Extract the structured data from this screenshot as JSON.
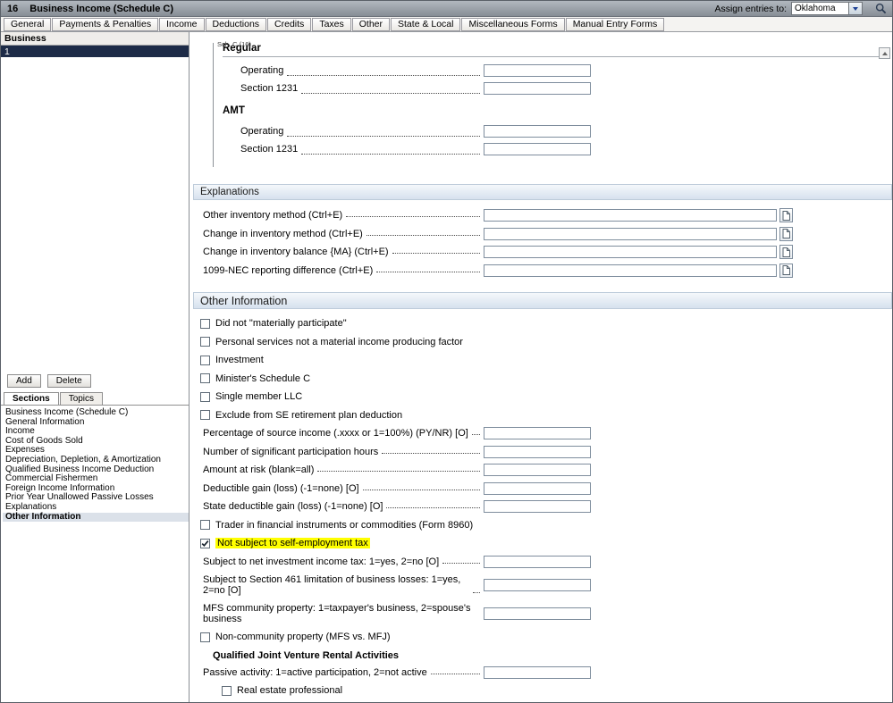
{
  "title_bar": {
    "form_number": "16",
    "title": "Business Income (Schedule C)",
    "assign_entries_label": "Assign entries to:",
    "assign_entries_value": "Oklahoma"
  },
  "tabs": [
    "General",
    "Payments & Penalties",
    "Income",
    "Deductions",
    "Credits",
    "Taxes",
    "Other",
    "State & Local",
    "Miscellaneous Forms",
    "Manual Entry Forms"
  ],
  "sidebar": {
    "header": "Business",
    "business_items": [
      {
        "label": "1",
        "selected": true
      }
    ],
    "buttons": {
      "add": "Add",
      "delete": "Delete"
    },
    "tabs": [
      {
        "label": "Sections",
        "active": true
      },
      {
        "label": "Topics",
        "active": false
      }
    ],
    "section_list": [
      {
        "label": "Business Income (Schedule C)",
        "selected": false
      },
      {
        "label": "General Information",
        "selected": false
      },
      {
        "label": "Income",
        "selected": false
      },
      {
        "label": "Cost of Goods Sold",
        "selected": false
      },
      {
        "label": "Expenses",
        "selected": false
      },
      {
        "label": "Depreciation, Depletion, & Amortization",
        "selected": false
      },
      {
        "label": "Qualified Business Income Deduction",
        "selected": false
      },
      {
        "label": "Commercial Fishermen",
        "selected": false
      },
      {
        "label": "Foreign Income Information",
        "selected": false
      },
      {
        "label": "Prior Year Unallowed Passive Losses",
        "selected": false
      },
      {
        "label": "Explanations",
        "selected": false
      },
      {
        "label": "Other Information",
        "selected": true
      }
    ]
  },
  "content": {
    "form_tag": "Sch. C  (16)",
    "gains": {
      "groups": [
        {
          "heading": "Regular",
          "rows": [
            {
              "label": "Operating",
              "value": ""
            },
            {
              "label": "Section 1231",
              "value": ""
            }
          ]
        },
        {
          "heading": "AMT",
          "rows": [
            {
              "label": "Operating",
              "value": ""
            },
            {
              "label": "Section 1231",
              "value": ""
            }
          ]
        }
      ]
    },
    "explanations": {
      "heading": "Explanations",
      "rows": [
        {
          "label": "Other inventory method (Ctrl+E)",
          "value": ""
        },
        {
          "label": "Change in inventory method (Ctrl+E)",
          "value": ""
        },
        {
          "label": "Change in inventory balance {MA} (Ctrl+E)",
          "value": ""
        },
        {
          "label": "1099-NEC reporting difference (Ctrl+E)",
          "value": ""
        }
      ]
    },
    "other_information": {
      "heading": "Other Information",
      "rows": [
        {
          "type": "checkbox",
          "label": "Did not \"materially participate\"",
          "checked": false
        },
        {
          "type": "checkbox",
          "label": "Personal services not a material income producing factor",
          "checked": false
        },
        {
          "type": "checkbox",
          "label": "Investment",
          "checked": false
        },
        {
          "type": "checkbox",
          "label": "Minister's Schedule C",
          "checked": false
        },
        {
          "type": "checkbox",
          "label": "Single member LLC",
          "checked": false
        },
        {
          "type": "checkbox",
          "label": "Exclude from SE retirement plan deduction",
          "checked": false
        },
        {
          "type": "field",
          "label": "Percentage of source income (.xxxx or 1=100%) (PY/NR) [O]",
          "value": ""
        },
        {
          "type": "field",
          "label": "Number of significant participation hours",
          "value": ""
        },
        {
          "type": "field",
          "label": "Amount at risk (blank=all)",
          "value": ""
        },
        {
          "type": "field",
          "label": "Deductible gain (loss) (-1=none) [O]",
          "value": ""
        },
        {
          "type": "field",
          "label": "State deductible gain (loss) (-1=none) [O]",
          "value": ""
        },
        {
          "type": "checkbox",
          "label": "Trader in financial instruments or commodities (Form 8960)",
          "checked": false
        },
        {
          "type": "checkbox",
          "label": "Not subject to self-employment tax",
          "checked": true,
          "highlight": true
        },
        {
          "type": "field",
          "label": "Subject to net investment income tax: 1=yes, 2=no [O]",
          "value": ""
        },
        {
          "type": "field",
          "label": "Subject to Section 461 limitation of business losses: 1=yes, 2=no [O]",
          "value": "",
          "wrap": true
        },
        {
          "type": "field",
          "label": "MFS community property: 1=taxpayer's business, 2=spouse's business",
          "value": "",
          "wrap": true,
          "no_leader": true
        },
        {
          "type": "checkbox",
          "label": "Non-community property (MFS vs. MFJ)",
          "checked": false
        },
        {
          "type": "heading",
          "label": "Qualified Joint Venture Rental Activities"
        },
        {
          "type": "field",
          "label": "Passive activity: 1=active participation, 2=not active",
          "value": ""
        },
        {
          "type": "checkbox",
          "label": "Real estate professional",
          "checked": false,
          "indent": true
        }
      ]
    }
  },
  "colors": {
    "highlight_yellow": "#ffff00",
    "selected_business_bg": "#1d2b47",
    "section_header_bg": "#d6e1ee",
    "selected_section_bg": "#dbe1e9"
  }
}
